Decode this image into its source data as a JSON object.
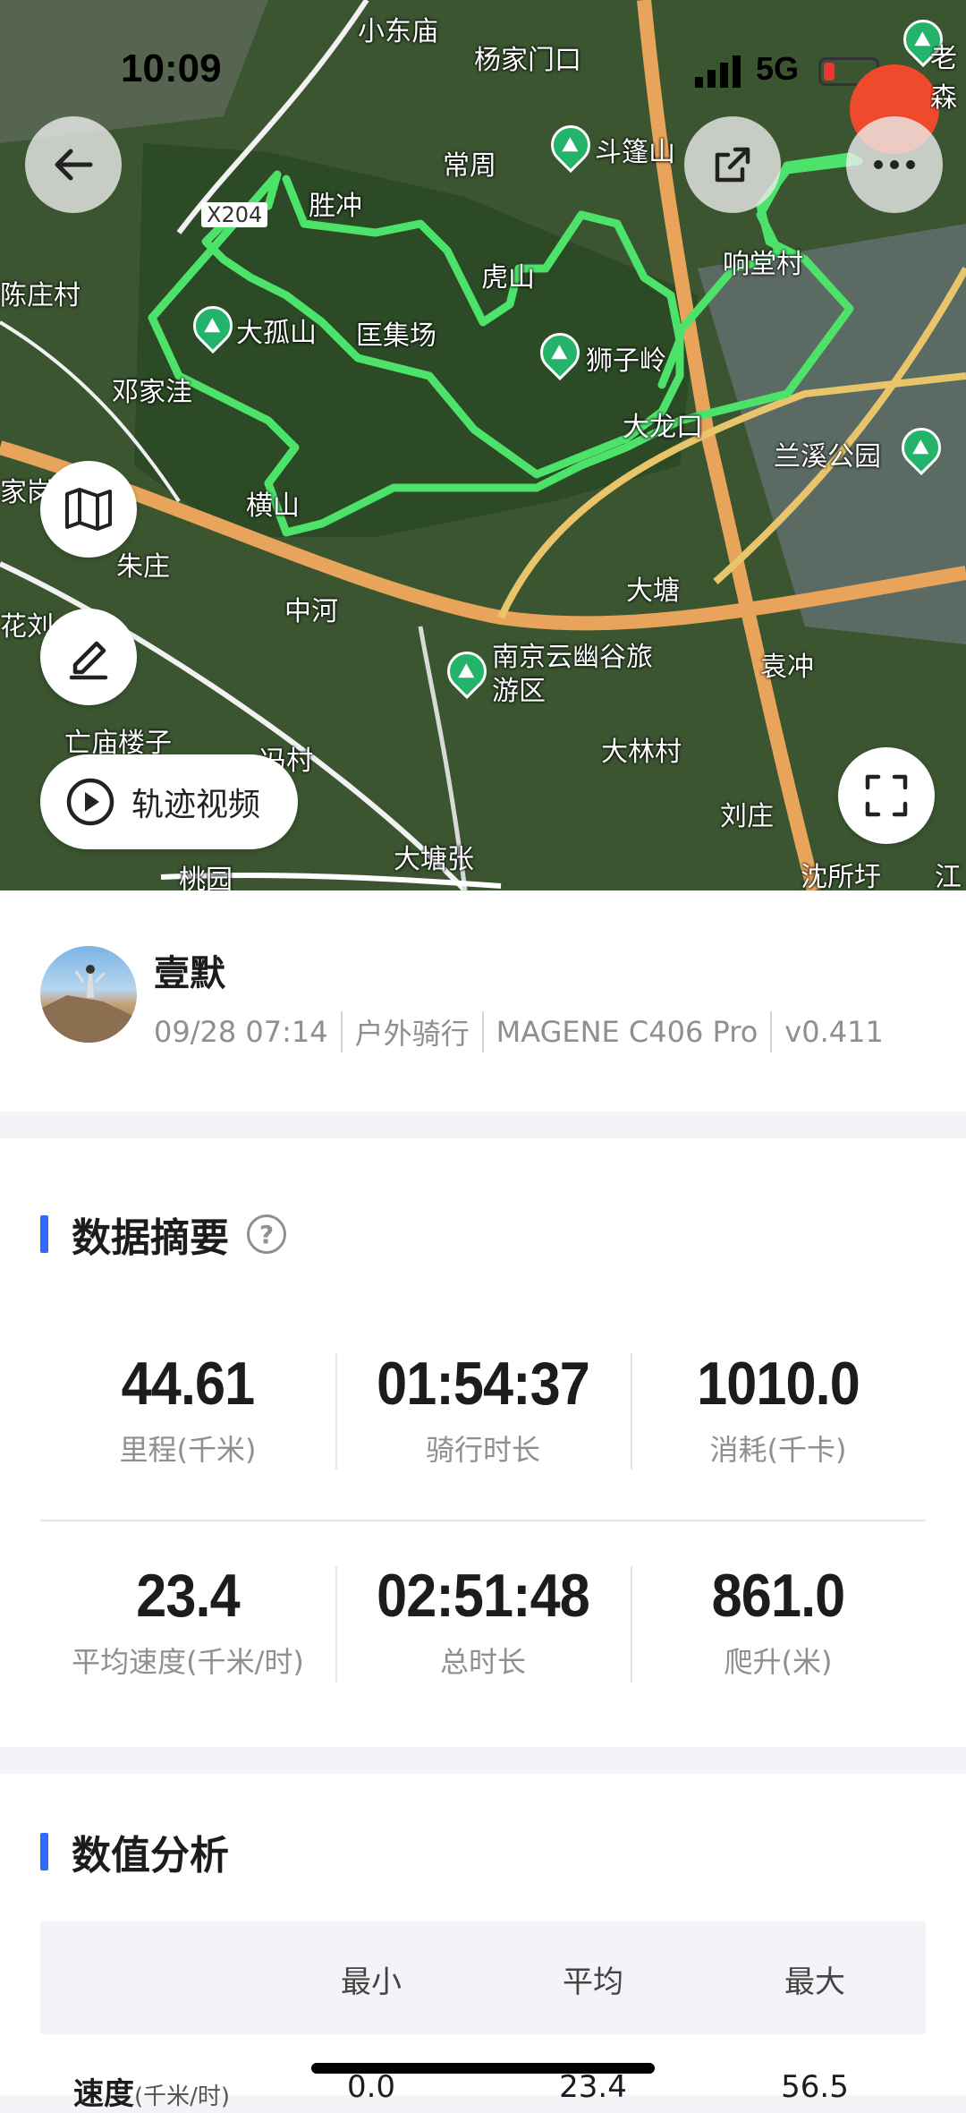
{
  "status_bar": {
    "time": "10:09",
    "network": "5G"
  },
  "map": {
    "places": [
      "小东庙",
      "杨家门口",
      "常周",
      "胜冲",
      "X204",
      "虎山",
      "匡集场",
      "陈庄村",
      "邓家洼",
      "家岗",
      "横山",
      "朱庄",
      "中河",
      "花刘",
      "亡庙楼子",
      "冯村",
      "桃园",
      "大塘张",
      "大林村",
      "刘庄",
      "沈所圩",
      "袁冲",
      "大塘",
      "大龙口",
      "兰溪公园",
      "响堂村",
      "江"
    ],
    "pois": [
      "斗篷山",
      "大孤山",
      "狮子岭",
      "南京云幽谷旅游区",
      "老森"
    ],
    "track_color": "#4de36b",
    "track_video_label": "轨迹视频"
  },
  "activity": {
    "user_name": "壹默",
    "date": "09/28 07:14",
    "sport": "户外骑行",
    "device": "MAGENE C406 Pro",
    "version": "v0.411"
  },
  "summary": {
    "title": "数据摘要",
    "help": "?",
    "stats": [
      {
        "value": "44.61",
        "label": "里程(千米)"
      },
      {
        "value": "01:54:37",
        "label": "骑行时长"
      },
      {
        "value": "1010.0",
        "label": "消耗(千卡)"
      },
      {
        "value": "23.4",
        "label": "平均速度(千米/时)"
      },
      {
        "value": "02:51:48",
        "label": "总时长"
      },
      {
        "value": "861.0",
        "label": "爬升(米)"
      }
    ]
  },
  "analysis": {
    "title": "数值分析",
    "headers": {
      "min": "最小",
      "avg": "平均",
      "max": "最大"
    },
    "row": {
      "label": "速度",
      "unit": "(千米/时)",
      "min": "0.0",
      "avg": "23.4",
      "max": "56.5"
    }
  },
  "colors": {
    "accent": "#2f6bff",
    "poi": "#24b36b",
    "record": "#ef4a2b"
  }
}
